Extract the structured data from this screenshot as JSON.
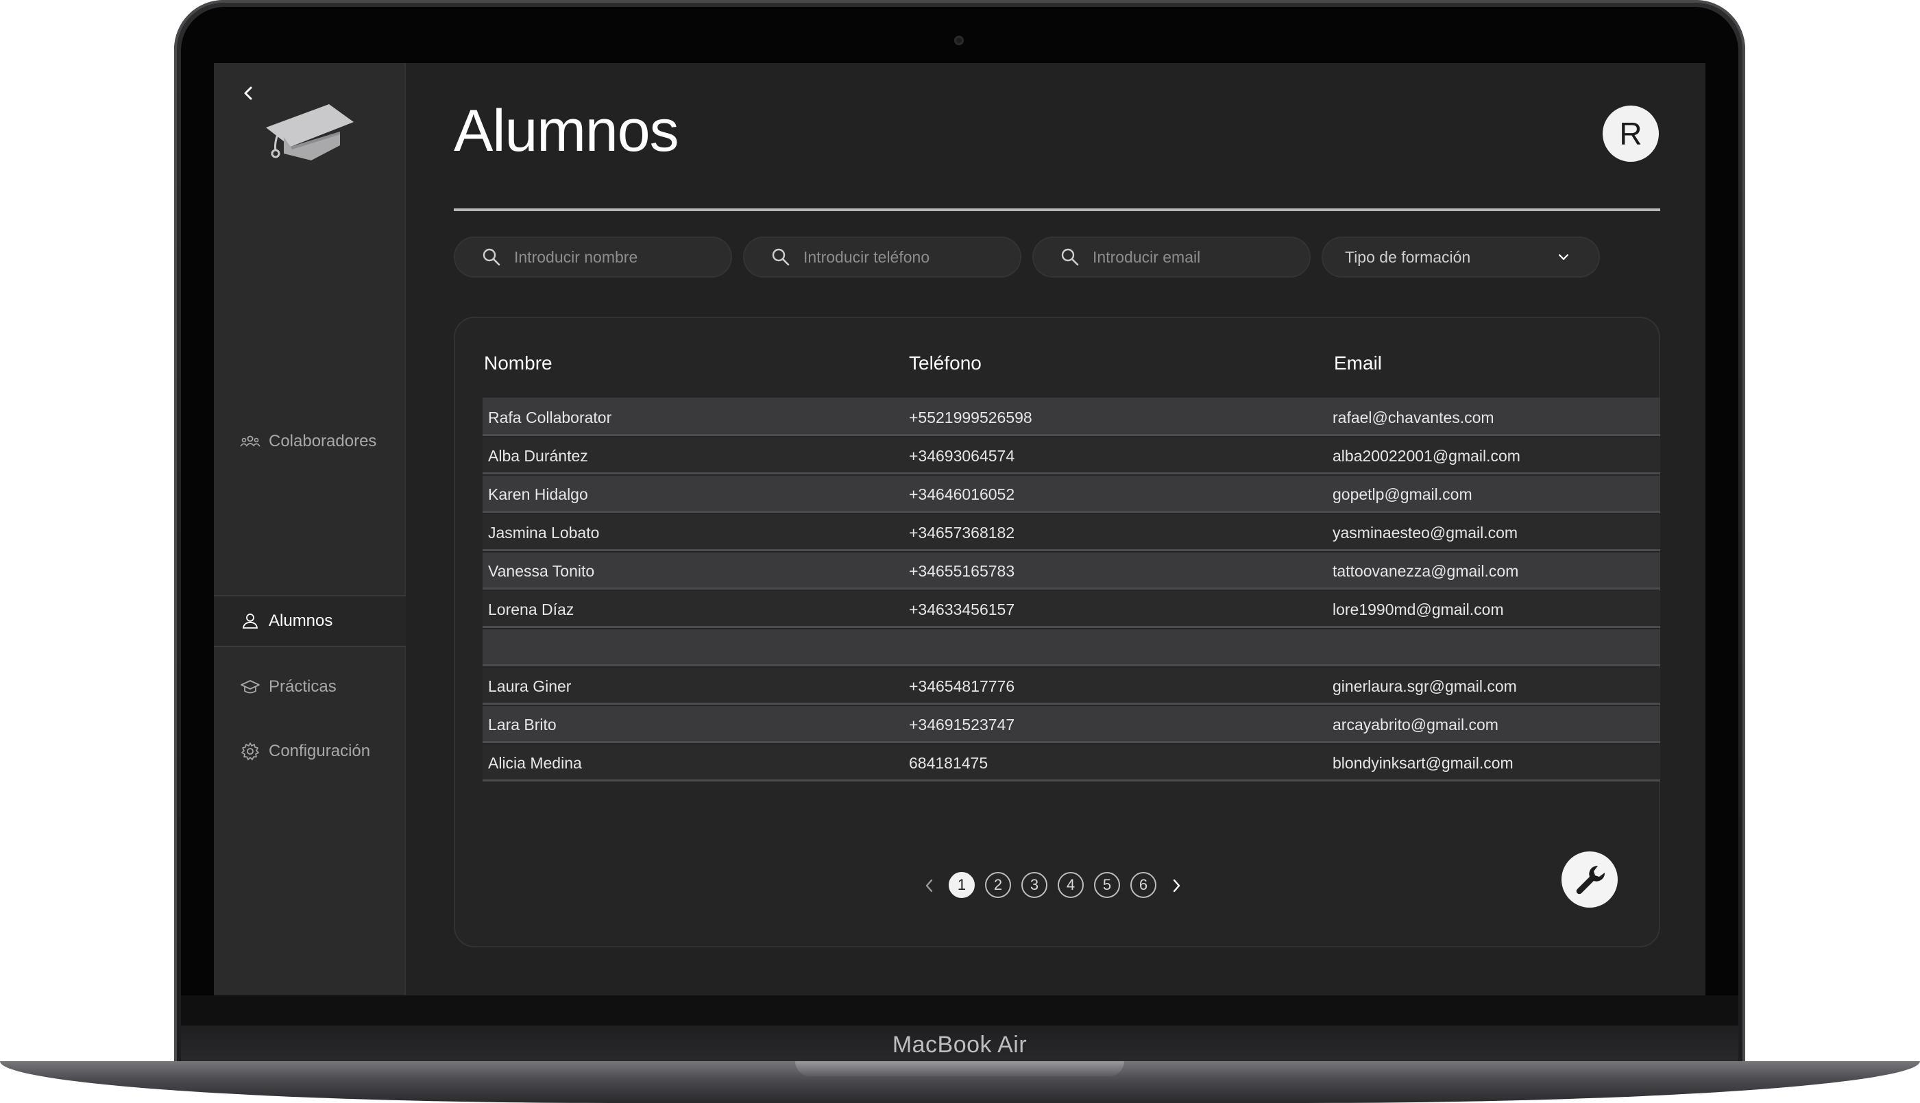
{
  "device": {
    "label": "MacBook Air"
  },
  "sidebar": {
    "items": [
      {
        "label": "Colaboradores",
        "icon": "users-icon"
      },
      {
        "label": "Alumnos",
        "icon": "user-icon",
        "active": true
      },
      {
        "label": "Prácticas",
        "icon": "graduation-cap-icon"
      },
      {
        "label": "Configuración",
        "icon": "gear-icon"
      }
    ]
  },
  "header": {
    "title": "Alumnos",
    "avatar_initial": "R"
  },
  "filters": {
    "name_placeholder": "Introducir nombre",
    "phone_placeholder": "Introducir teléfono",
    "email_placeholder": "Introducir email",
    "training_type_label": "Tipo de formación"
  },
  "table": {
    "columns": [
      "Nombre",
      "Teléfono",
      "Email"
    ],
    "rows": [
      [
        "Rafa Collaborator",
        "+5521999526598",
        "rafael@chavantes.com"
      ],
      [
        "Alba Durántez",
        "+34693064574",
        "alba20022001@gmail.com"
      ],
      [
        "Karen Hidalgo",
        "+34646016052",
        "gopetlp@gmail.com"
      ],
      [
        "Jasmina Lobato",
        "+34657368182",
        "yasminaesteo@gmail.com"
      ],
      [
        "Vanessa Tonito",
        "+34655165783",
        "tattoovanezza@gmail.com"
      ],
      [
        "Lorena Díaz",
        "+34633456157",
        "lore1990md@gmail.com"
      ],
      [
        "",
        "",
        ""
      ],
      [
        "Laura Giner",
        "+34654817776",
        "ginerlaura.sgr@gmail.com"
      ],
      [
        "Lara Brito",
        "+34691523747",
        "arcayabrito@gmail.com"
      ],
      [
        "Alicia Medina",
        "684181475",
        "blondyinksart@gmail.com"
      ]
    ]
  },
  "pagination": {
    "pages": [
      "1",
      "2",
      "3",
      "4",
      "5",
      "6"
    ],
    "current": "1"
  },
  "colors": {
    "screen_bg": "#222223",
    "sidebar_bg": "#2b2b2c",
    "row_odd": "#3a3a3c",
    "row_even": "#2a2a2b",
    "accent": "#f2f2f2"
  }
}
